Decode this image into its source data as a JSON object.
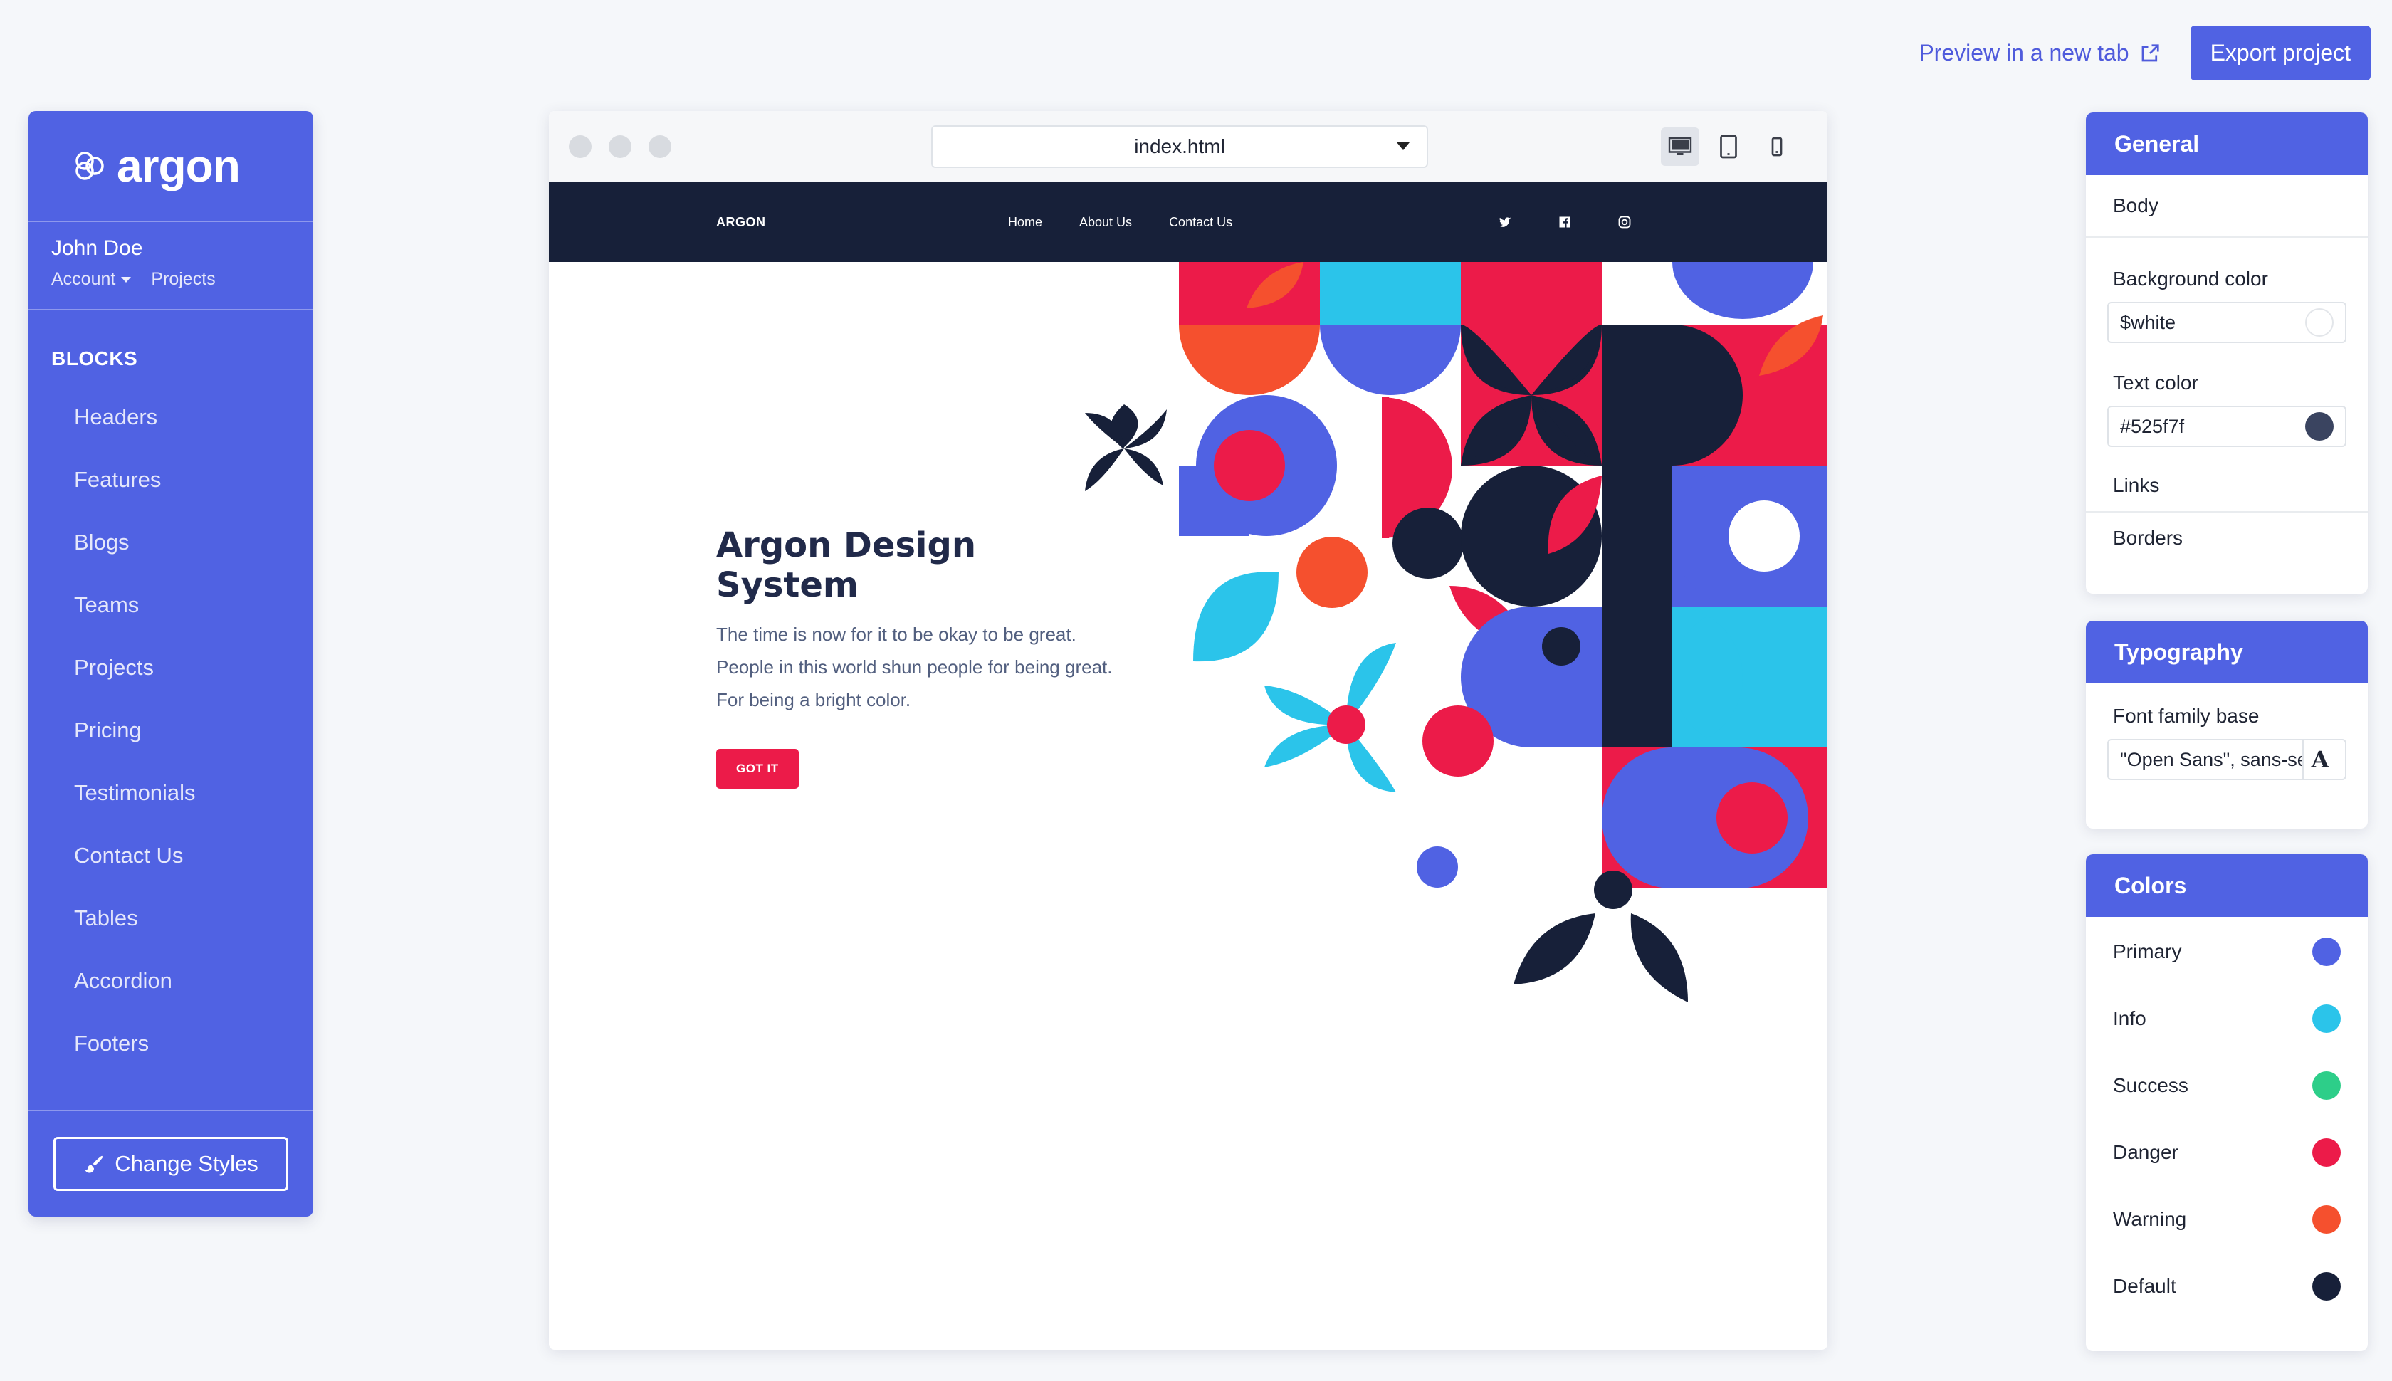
{
  "top": {
    "preview_label": "Preview in a new tab",
    "export_label": "Export project"
  },
  "sidebar": {
    "brand": "argon",
    "user_name": "John Doe",
    "account_label": "Account",
    "projects_label": "Projects",
    "blocks_title": "BLOCKS",
    "items": [
      "Headers",
      "Features",
      "Blogs",
      "Teams",
      "Projects",
      "Pricing",
      "Testimonials",
      "Contact Us",
      "Tables",
      "Accordion",
      "Footers"
    ],
    "change_styles_label": "Change Styles"
  },
  "browser": {
    "url": "index.html",
    "devices": [
      "desktop-icon",
      "tablet-icon",
      "mobile-icon"
    ],
    "active_device": "desktop"
  },
  "site": {
    "brand": "ARGON",
    "nav": [
      "Home",
      "About Us",
      "Contact Us"
    ],
    "social": [
      "twitter-icon",
      "facebook-icon",
      "instagram-icon"
    ],
    "title": "Argon Design System",
    "text": "The time is now for it to be okay to be great. People in this world shun people for being great. For being a bright color.",
    "button": "GOT IT"
  },
  "panels": {
    "general": {
      "title": "General",
      "body_label": "Body",
      "bg_label": "Background color",
      "bg_value": "$white",
      "text_label": "Text color",
      "text_value": "#525f7f",
      "links_label": "Links",
      "borders_label": "Borders"
    },
    "typography": {
      "title": "Typography",
      "font_label": "Font family base",
      "font_value": "\"Open Sans\", sans-serif"
    },
    "colors": {
      "title": "Colors",
      "items": [
        {
          "label": "Primary",
          "color": "#5062e3"
        },
        {
          "label": "Info",
          "color": "#2bc4ea"
        },
        {
          "label": "Success",
          "color": "#2dce89"
        },
        {
          "label": "Danger",
          "color": "#ec1b49"
        },
        {
          "label": "Warning",
          "color": "#f5502e"
        },
        {
          "label": "Default",
          "color": "#172039"
        }
      ]
    }
  },
  "colors": {
    "primary": "#5062e3",
    "dark": "#172039",
    "danger": "#ec1b49",
    "info": "#2bc4ea",
    "warning": "#f5502e"
  }
}
